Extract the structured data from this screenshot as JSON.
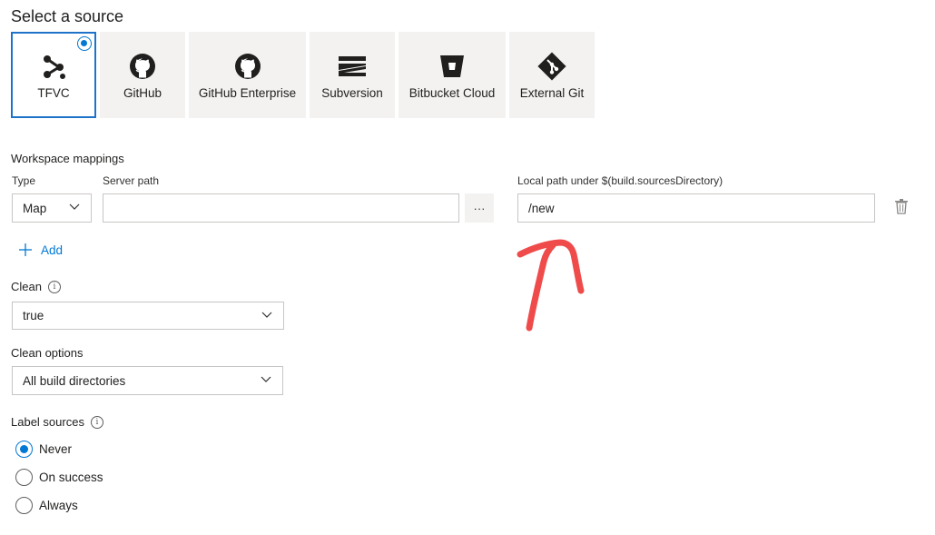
{
  "page_title": "Select a source",
  "sources": [
    {
      "label": "TFVC",
      "icon": "tfvc-icon",
      "selected": true
    },
    {
      "label": "GitHub",
      "icon": "github-icon",
      "selected": false
    },
    {
      "label": "GitHub Enterprise",
      "icon": "github-icon",
      "selected": false
    },
    {
      "label": "Subversion",
      "icon": "subversion-icon",
      "selected": false
    },
    {
      "label": "Bitbucket Cloud",
      "icon": "bitbucket-icon",
      "selected": false
    },
    {
      "label": "External Git",
      "icon": "git-icon",
      "selected": false
    }
  ],
  "workspace": {
    "heading": "Workspace mappings",
    "type_label": "Type",
    "server_path_label": "Server path",
    "local_path_label": "Local path under $(build.sourcesDirectory)",
    "mapping": {
      "type": "Map",
      "server_path": "",
      "local_path": "/new"
    },
    "browse_label": "···",
    "add_label": "Add"
  },
  "clean": {
    "label": "Clean",
    "value": "true"
  },
  "clean_options": {
    "label": "Clean options",
    "value": "All build directories"
  },
  "label_sources": {
    "label": "Label sources",
    "options": [
      {
        "label": "Never",
        "selected": true
      },
      {
        "label": "On success",
        "selected": false
      },
      {
        "label": "Always",
        "selected": false
      }
    ]
  },
  "colors": {
    "accent": "#0078d4",
    "annotation": "#ef4b4b",
    "tile_bg": "#f3f2f1"
  }
}
